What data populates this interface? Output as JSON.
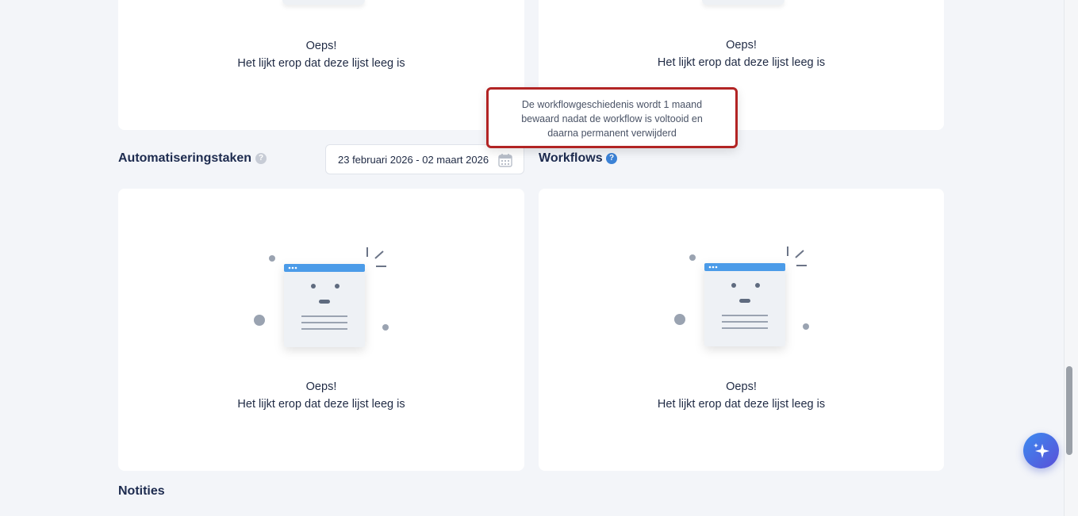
{
  "empty_state": {
    "title": "Oeps!",
    "message": "Het lijkt erop dat deze lijst leeg is"
  },
  "tooltip": {
    "text_line1": "De workflowgeschiedenis wordt 1 maand",
    "text_line2": "bewaard nadat de workflow is voltooid en",
    "text_line3": "daarna permanent verwijderd"
  },
  "automation": {
    "title": "Automatiseringstaken",
    "help": "?",
    "date_range": "23 februari 2026 - 02 maart 2026"
  },
  "workflows": {
    "title": "Workflows",
    "help": "?"
  },
  "notes": {
    "title": "Notities"
  },
  "icons": {
    "calendar": "calendar-icon",
    "help": "help-icon",
    "ai_assistant": "sparkle-icon"
  },
  "colors": {
    "accent": "#3b82d6",
    "tooltip_border": "#b22424",
    "fab_gradient_start": "#3c8bf0",
    "fab_gradient_end": "#5a4fd8"
  }
}
